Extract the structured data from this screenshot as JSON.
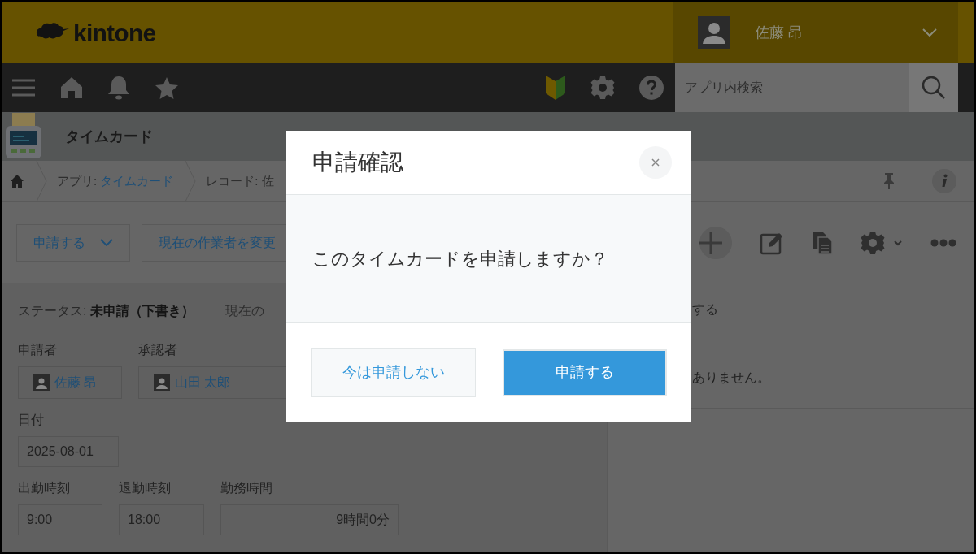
{
  "header": {
    "logo": "kintone",
    "user_name": "佐藤 昂"
  },
  "nav": {
    "search": {
      "placeholder": "アプリ内検索"
    }
  },
  "app": {
    "title": "タイムカード"
  },
  "breadcrumb": [
    {
      "prefix": "アプリ: ",
      "link": "タイムカード"
    },
    {
      "prefix": "レコード: 佐"
    }
  ],
  "toolbar": {
    "buttons": [
      {
        "label": "申請する",
        "kind": "dropdown"
      },
      {
        "label": "現在の作業者を変更",
        "kind": "plain"
      }
    ]
  },
  "status": {
    "label": "ステータス: ",
    "value": "未申請（下書き）",
    "assignee_label": "現在の"
  },
  "field_rows": [
    [
      {
        "label": "申請者",
        "kind": "user",
        "value": "佐藤 昂"
      },
      {
        "label": "承認者",
        "kind": "user",
        "value": "山田 太郎"
      }
    ],
    [
      {
        "label": "日付",
        "kind": "text",
        "value": "2025-08-01"
      }
    ],
    [
      {
        "label": "出勤時刻",
        "kind": "text",
        "value": "9:00"
      },
      {
        "label": "退勤時刻",
        "kind": "text",
        "value": "18:00"
      },
      {
        "label": "勤務時間",
        "kind": "number",
        "value": "9時間0分"
      }
    ]
  ],
  "side_panel": {
    "rows": [
      "する",
      "ありません。"
    ]
  },
  "dialog": {
    "title": "申請確認",
    "message": "このタイムカードを申請しますか？",
    "cancel": "今は申請しない",
    "confirm": "申請する"
  }
}
